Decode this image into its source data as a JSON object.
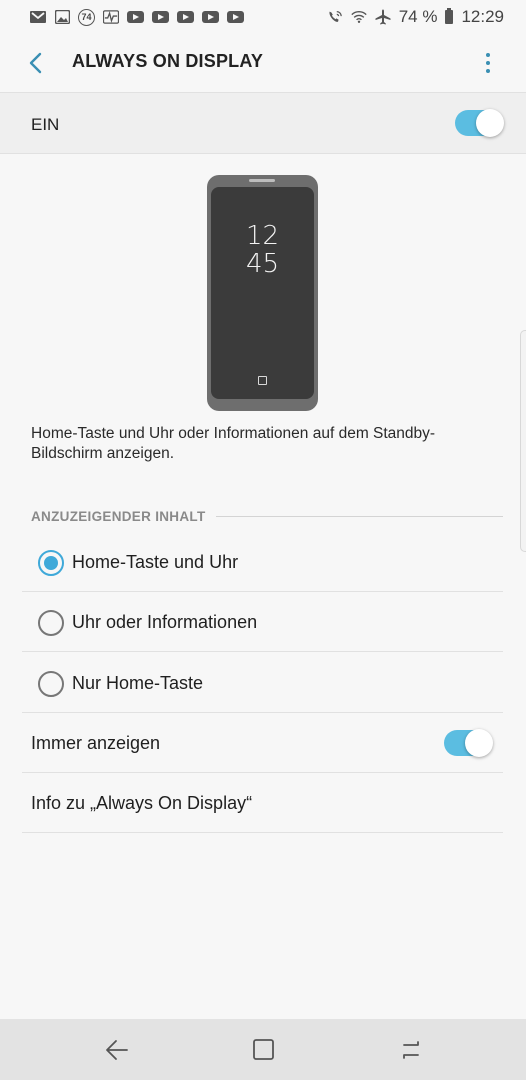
{
  "status_bar": {
    "notification_icons": [
      "gmail-icon",
      "image-icon",
      "badge-74-icon",
      "activity-icon",
      "youtube-icon",
      "youtube-icon",
      "youtube-icon",
      "youtube-icon",
      "youtube-icon"
    ],
    "badge": "74",
    "battery": "74 %",
    "time": "12:29"
  },
  "app_bar": {
    "title": "ALWAYS ON DISPLAY"
  },
  "master_toggle": {
    "label": "EIN",
    "on": true
  },
  "preview": {
    "clock_hours": "12",
    "clock_minutes": "45"
  },
  "description": "Home-Taste und Uhr oder Informationen auf dem Standby-Bildschirm anzeigen.",
  "content_section": {
    "header": "ANZUZEIGENDER INHALT",
    "options": [
      {
        "label": "Home-Taste und Uhr",
        "selected": true
      },
      {
        "label": "Uhr oder Informationen",
        "selected": false
      },
      {
        "label": "Nur Home-Taste",
        "selected": false
      }
    ]
  },
  "always_show": {
    "label": "Immer anzeigen",
    "on": true
  },
  "info_link": {
    "label": "Info zu „Always On Display“"
  },
  "colors": {
    "accent": "#3fa9d9",
    "toggle": "#5bbde1",
    "background": "#f7f7f7"
  }
}
